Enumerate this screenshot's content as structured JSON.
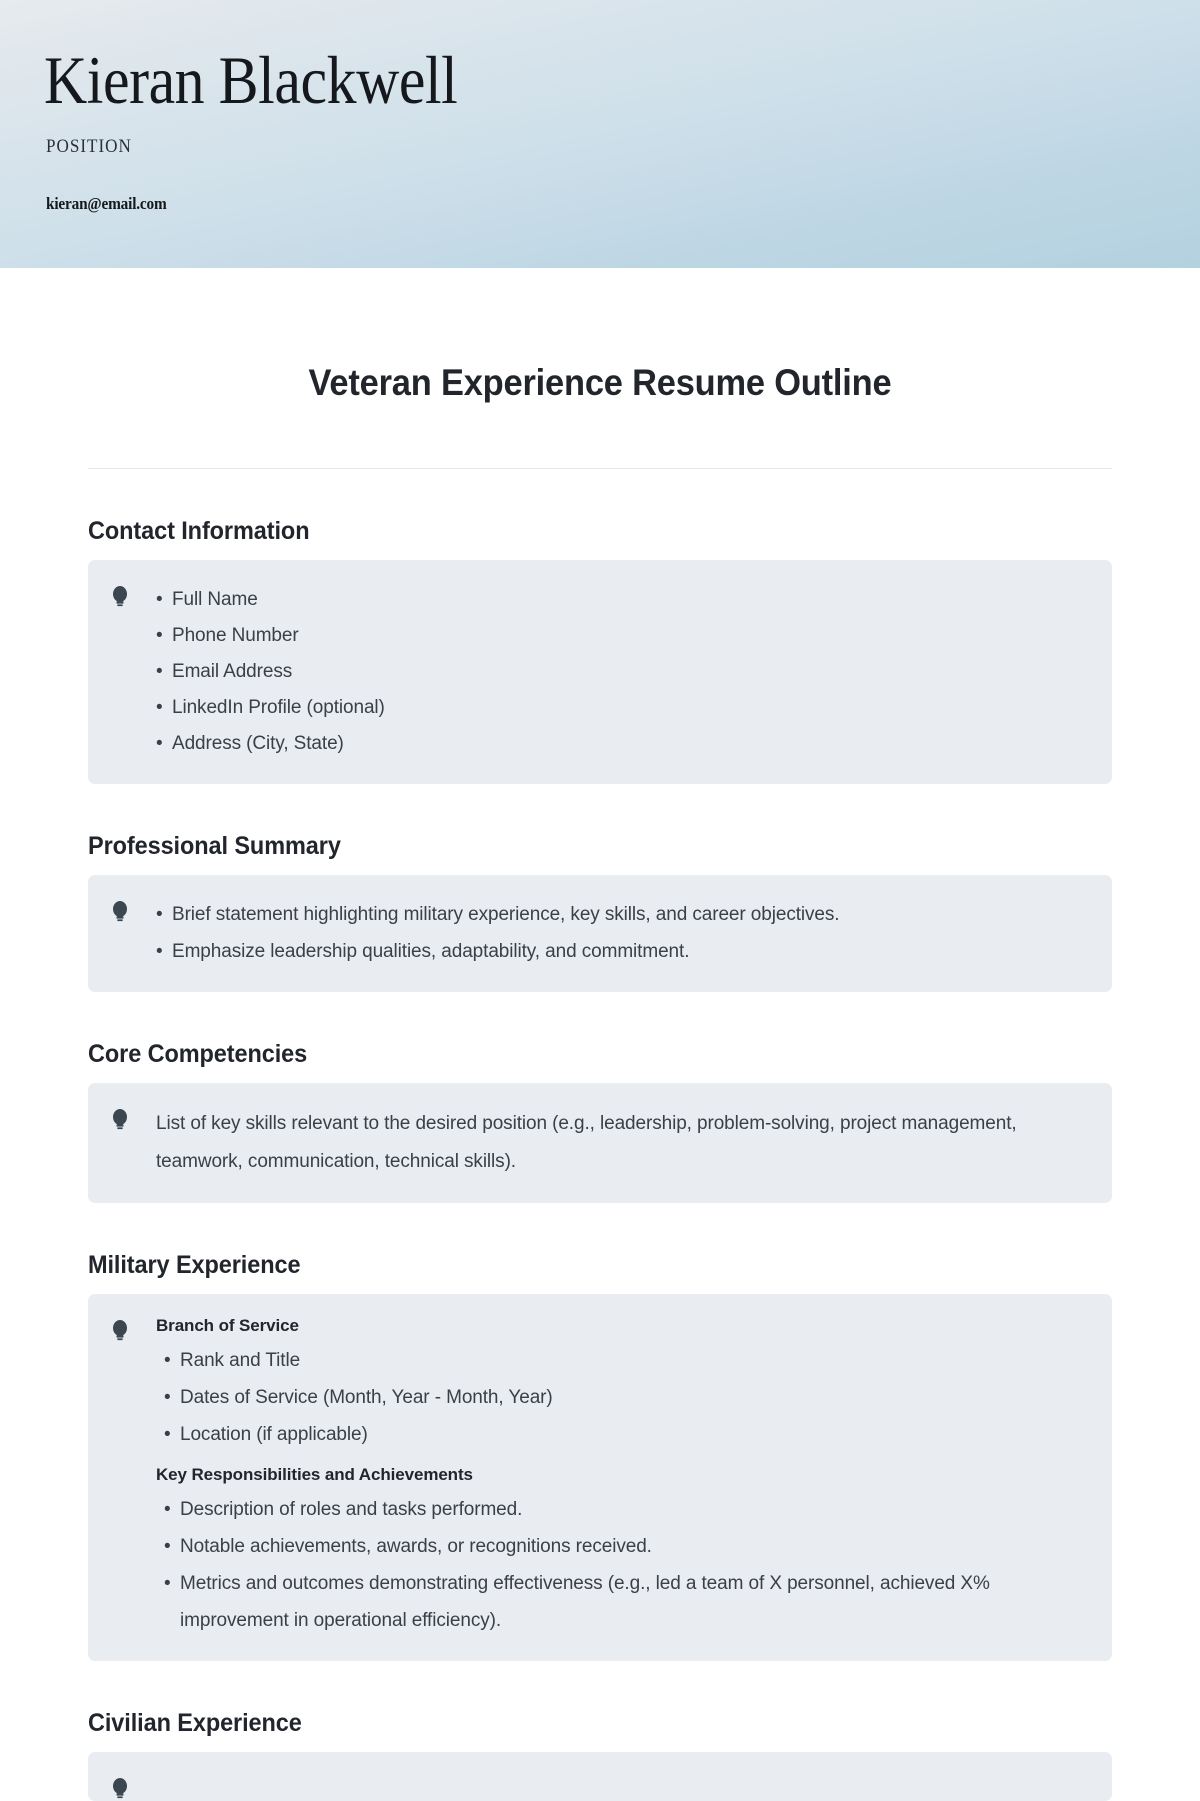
{
  "header": {
    "name": "Kieran Blackwell",
    "position_label": "POSITION",
    "email": "kieran@email.com",
    "gradient_from": "#e6ebee",
    "gradient_to": "#b4d1e0"
  },
  "document": {
    "title": "Veteran Experience Resume Outline",
    "box_bg": "#e9edf1",
    "icon_name": "lightbulb-icon",
    "icon_color": "#3c4650"
  },
  "sections": [
    {
      "heading": "Contact Information",
      "bullets": [
        "Full Name",
        "Phone Number",
        "Email Address",
        "LinkedIn Profile (optional)",
        "Address (City, State)"
      ]
    },
    {
      "heading": "Professional Summary",
      "bullets": [
        "Brief statement highlighting military experience, key skills, and career objectives.",
        "Emphasize leadership qualities, adaptability, and commitment."
      ]
    },
    {
      "heading": "Core Competencies",
      "paragraph": "List of key skills relevant to the desired position (e.g., leadership, problem-solving, project management, teamwork, communication, technical skills)."
    },
    {
      "heading": "Military Experience",
      "sub_heading_1": "Branch of Service",
      "bullets_1": [
        "Rank and Title",
        "Dates of Service (Month, Year - Month, Year)",
        "Location (if applicable)"
      ],
      "sub_heading_2": "Key Responsibilities and Achievements",
      "bullets_2": [
        "Description of roles and tasks performed.",
        "Notable achievements, awards, or recognitions received.",
        "Metrics and outcomes demonstrating effectiveness (e.g., led a team of X personnel, achieved X% improvement in operational efficiency)."
      ]
    },
    {
      "heading": "Civilian Experience"
    }
  ]
}
